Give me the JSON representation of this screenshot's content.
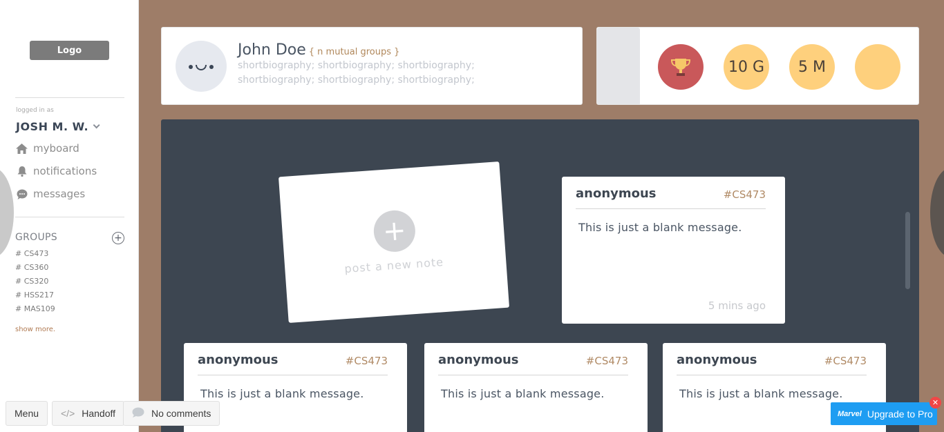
{
  "sidebar": {
    "logo": "Logo",
    "logged_in_label": "logged in as",
    "user_name": "JOSH M. W.",
    "nav": [
      {
        "label": "myboard",
        "icon": "home-icon"
      },
      {
        "label": "notifications",
        "icon": "bell-icon"
      },
      {
        "label": "messages",
        "icon": "chat-icon"
      }
    ],
    "groups_title": "GROUPS",
    "groups": [
      "#  CS473",
      "#  CS360",
      "#  CS320",
      "#  HSS217",
      "#  MAS109"
    ],
    "show_more": "show more."
  },
  "profile": {
    "name": "John Doe",
    "mutual": "{ n mutual groups }",
    "bio_line1": "shortbiography; shortbiography; shortbiography;",
    "bio_line2": "shortbiography; shortbiography; shortbiography;"
  },
  "badges": [
    {
      "label": "",
      "icon": "trophy-icon"
    },
    {
      "label": "10 G"
    },
    {
      "label": "5 M"
    },
    {
      "label": ""
    }
  ],
  "post_note": {
    "label": "post a new note"
  },
  "notes": [
    {
      "author": "anonymous",
      "tag": "#CS473",
      "body": "This is just a blank message.",
      "time": "5 mins ago"
    },
    {
      "author": "anonymous",
      "tag": "#CS473",
      "body": "This is just a blank message."
    },
    {
      "author": "anonymous",
      "tag": "#CS473",
      "body": "This is just a blank message."
    },
    {
      "author": "anonymous",
      "tag": "#CS473",
      "body": "This is just a blank message."
    }
  ],
  "toolbar": {
    "menu": "Menu",
    "handoff": "Handoff",
    "comments": "No comments",
    "upgrade": "Upgrade to Pro",
    "upgrade_brand": "Marvel"
  },
  "colors": {
    "background": "#9e7d68",
    "board": "#3d4651",
    "badge": "#fed07d",
    "trophy_badge": "#c9585a",
    "tag": "#b08a65",
    "upgrade": "#1e9df2"
  }
}
